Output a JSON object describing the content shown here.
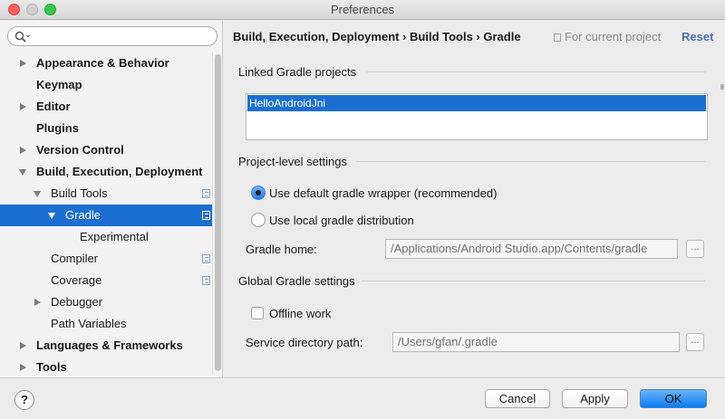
{
  "window": {
    "title": "Preferences"
  },
  "search": {
    "placeholder": ""
  },
  "sidebar": {
    "items": [
      {
        "label": "Appearance & Behavior",
        "bold": true,
        "arrow": "right"
      },
      {
        "label": "Keymap",
        "bold": true,
        "arrow": "none"
      },
      {
        "label": "Editor",
        "bold": true,
        "arrow": "right"
      },
      {
        "label": "Plugins",
        "bold": true,
        "arrow": "none"
      },
      {
        "label": "Version Control",
        "bold": true,
        "arrow": "right"
      },
      {
        "label": "Build, Execution, Deployment",
        "bold": true,
        "arrow": "down"
      },
      {
        "label": "Build Tools",
        "bold": false,
        "arrow": "down",
        "project_icon": true
      },
      {
        "label": "Gradle",
        "bold": false,
        "arrow": "down",
        "selected": true,
        "project_icon": true
      },
      {
        "label": "Experimental",
        "bold": false,
        "arrow": "none"
      },
      {
        "label": "Compiler",
        "bold": false,
        "arrow": "none",
        "project_icon": true
      },
      {
        "label": "Coverage",
        "bold": false,
        "arrow": "none",
        "project_icon": true
      },
      {
        "label": "Debugger",
        "bold": false,
        "arrow": "right"
      },
      {
        "label": "Path Variables",
        "bold": false,
        "arrow": "none"
      },
      {
        "label": "Languages & Frameworks",
        "bold": true,
        "arrow": "right"
      },
      {
        "label": "Tools",
        "bold": true,
        "arrow": "right"
      }
    ]
  },
  "header": {
    "breadcrumb": "Build, Execution, Deployment › Build Tools › Gradle",
    "scope": "For current project",
    "reset": "Reset"
  },
  "linked": {
    "title": "Linked Gradle projects",
    "projects": [
      "HelloAndroidJni"
    ]
  },
  "project_level": {
    "title": "Project-level settings",
    "option_default": "Use default gradle wrapper (recommended)",
    "option_local": "Use local gradle distribution",
    "selected": "default",
    "gradle_home_label": "Gradle home:",
    "gradle_home_value": "/Applications/Android Studio.app/Contents/gradle",
    "browse": "..."
  },
  "global": {
    "title": "Global Gradle settings",
    "offline_label": "Offline work",
    "offline_checked": false,
    "service_dir_label": "Service directory path:",
    "service_dir_value": "/Users/gfan/.gradle",
    "browse": "..."
  },
  "footer": {
    "help": "?",
    "cancel": "Cancel",
    "apply": "Apply",
    "ok": "OK"
  },
  "colors": {
    "selection": "#1c6fd1",
    "link": "#4a6db0",
    "primary_button": "#0b7bf3"
  }
}
